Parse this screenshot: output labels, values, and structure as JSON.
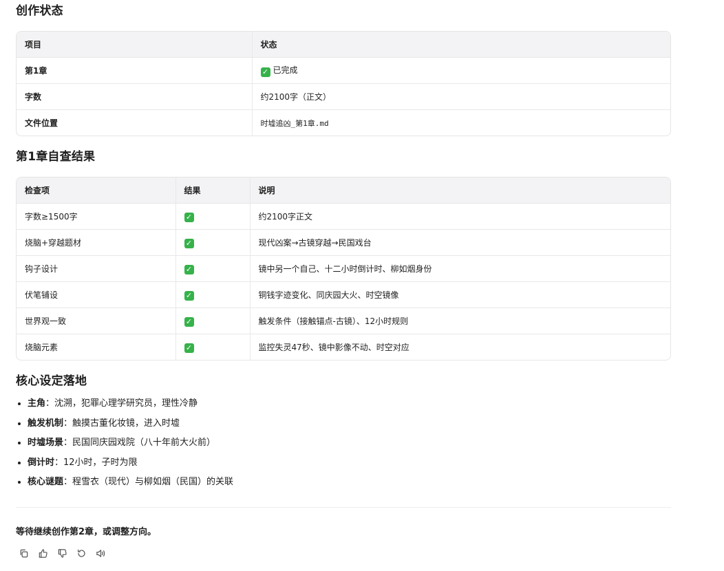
{
  "sections": {
    "status_title": "创作状态",
    "check_title": "第1章自查结果",
    "core_title": "核心设定落地"
  },
  "status_table": {
    "headers": [
      "项目",
      "状态"
    ],
    "rows": [
      {
        "item": "第1章",
        "value": "已完成",
        "check": true
      },
      {
        "item": "字数",
        "value": "约2100字（正文）"
      },
      {
        "item": "文件位置",
        "value": "时墟追凶_第1章.md"
      }
    ]
  },
  "check_table": {
    "headers": [
      "检查项",
      "结果",
      "说明"
    ],
    "rows": [
      {
        "item": "字数≥1500字",
        "result": "✓",
        "note": "约2100字正文"
      },
      {
        "item": "烧脑+穿越题材",
        "result": "✓",
        "note": "现代凶案→古镜穿越→民国戏台"
      },
      {
        "item": "钩子设计",
        "result": "✓",
        "note": "镜中另一个自己、十二小时倒计时、柳如烟身份"
      },
      {
        "item": "伏笔铺设",
        "result": "✓",
        "note": "铜钱字迹变化、同庆园大火、时空镜像"
      },
      {
        "item": "世界观一致",
        "result": "✓",
        "note": "触发条件（接触锚点-古镜）、12小时规则"
      },
      {
        "item": "烧脑元素",
        "result": "✓",
        "note": "监控失灵47秒、镜中影像不动、时空对应"
      }
    ]
  },
  "core_list": [
    {
      "key": "主角",
      "text": "：沈溯，犯罪心理学研究员，理性冷静"
    },
    {
      "key": "触发机制",
      "text": "：触摸古董化妆镜，进入时墟"
    },
    {
      "key": "时墟场景",
      "text": "：民国同庆园戏院（八十年前大火前）"
    },
    {
      "key": "倒计时",
      "text": "：12小时，子时为限"
    },
    {
      "key": "核心谜题",
      "text": "：程雪衣（现代）与柳如烟（民国）的关联"
    }
  ],
  "footer": {
    "message": "等待继续创作第2章，或调整方向。"
  },
  "actions": [
    {
      "name": "copy-icon"
    },
    {
      "name": "thumbs-up-icon"
    },
    {
      "name": "thumbs-down-icon"
    },
    {
      "name": "retry-icon"
    },
    {
      "name": "speaker-icon"
    }
  ],
  "colors": {
    "check_green": "#36b24a",
    "header_bg": "#f3f3f5",
    "border": "#e5e5e5"
  }
}
